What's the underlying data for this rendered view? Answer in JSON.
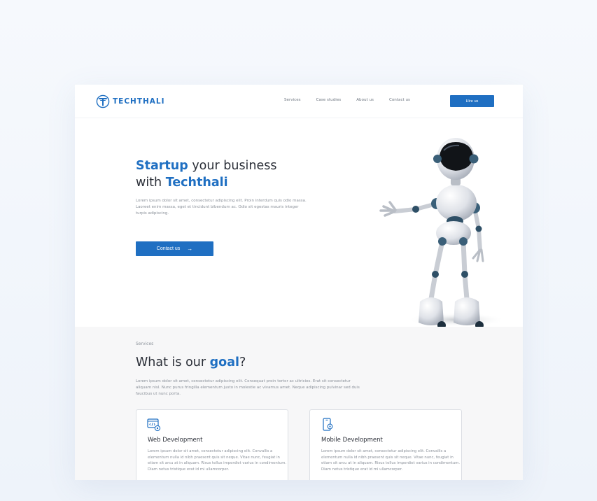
{
  "brand": {
    "name": "TECHTHALI",
    "accent": "#1f6fc2"
  },
  "nav": {
    "links": [
      "Services",
      "Case studies",
      "About us",
      "Contact us"
    ],
    "cta": "Hire us"
  },
  "hero": {
    "title_highlight_1": "Startup",
    "title_part_1": " your business",
    "title_part_2": "with ",
    "title_highlight_2": "Techthali",
    "description": "Lorem ipsum dolor sit amet, consectetur adipiscing elit. Proin interdum quis odio massa. Laoreet enim massa, eget et tincidunt bibendum ac. Odio sit egestas mauris integer turpis adipiscing.",
    "button": "Contact us",
    "button_icon": "arrow-right-icon"
  },
  "services": {
    "eyebrow": "Services",
    "title_part": "What is our ",
    "title_highlight": "goal",
    "title_end": "?",
    "description": "Lorem ipsum dolor sit amet, consectetur adipiscing elit. Consequat proin tortor ac ultricies. Erat sit consectetur aliquam nisl. Nunc purus fringilla elementum justo in molestie ac vivamus amet. Neque adipiscing pulvinar sed duis faucibus ut nunc porta.",
    "cards": [
      {
        "icon": "web-code-icon",
        "title": "Web Development",
        "text": "Lorem ipsum dolor sit amet, consectetur adipiscing elit. Convallis a elementum nulla id nibh praesent quis sit neque. Vitae nunc, feugiat in etiam sit arcu at in aliquam. Risus tellus imperdiet varius in condimentum. Diam netus tristique erat id mi ullamcorper."
      },
      {
        "icon": "mobile-settings-icon",
        "title": "Mobile Development",
        "text": "Lorem ipsum dolor sit amet, consectetur adipiscing elit. Convallis a elementum nulla id nibh praesent quis sit neque. Vitae nunc, feugiat in etiam sit arcu at in aliquam. Risus tellus imperdiet varius in condimentum. Diam netus tristique erat id mi ullamcorper."
      }
    ]
  }
}
